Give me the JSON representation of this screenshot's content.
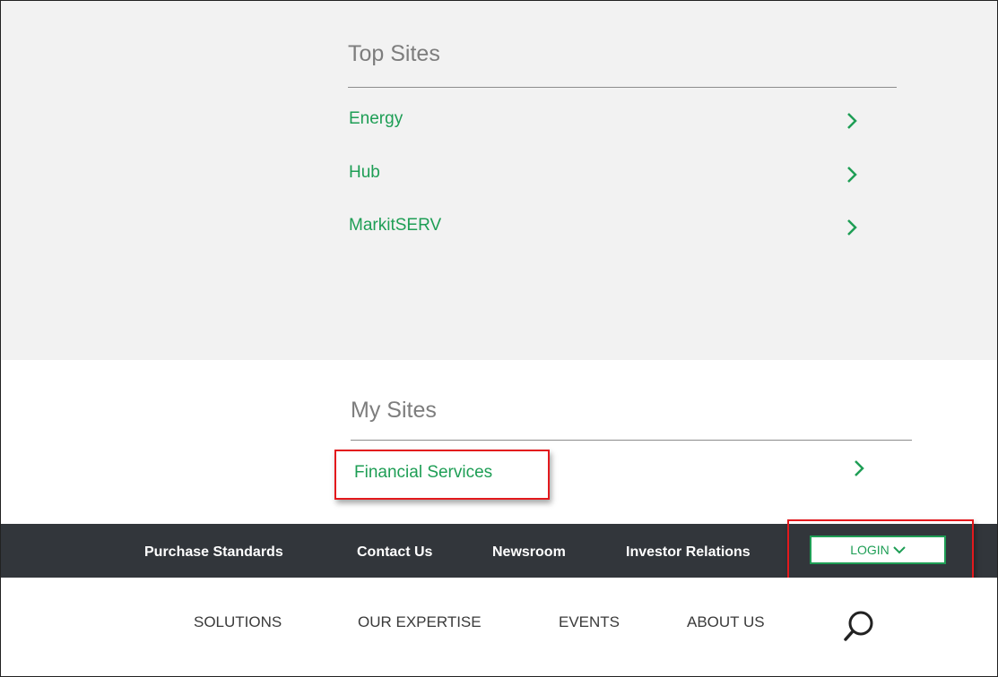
{
  "top_sites": {
    "title": "Top Sites",
    "items": [
      {
        "label": "Energy",
        "icon": "chevron-right-icon"
      },
      {
        "label": "Hub",
        "icon": "chevron-right-icon"
      },
      {
        "label": "MarkitSERV",
        "icon": "chevron-right-icon"
      }
    ]
  },
  "my_sites": {
    "title": "My Sites",
    "items": [
      {
        "label": "Financial Services",
        "icon": "chevron-right-icon"
      }
    ]
  },
  "utility_bar": {
    "links": [
      "Purchase Standards",
      "Contact Us",
      "Newsroom",
      "Investor Relations"
    ],
    "login_label": "LOGIN",
    "login_icon": "chevron-down-icon"
  },
  "main_nav": {
    "items": [
      "SOLUTIONS",
      "OUR EXPERTISE",
      "EVENTS",
      "ABOUT US"
    ],
    "search_icon": "search-icon"
  },
  "colors": {
    "accent_green": "#1e9e55",
    "utility_bar_bg": "#32363b",
    "panel_bg": "#f2f2f2",
    "highlight_red": "#e3191d"
  }
}
